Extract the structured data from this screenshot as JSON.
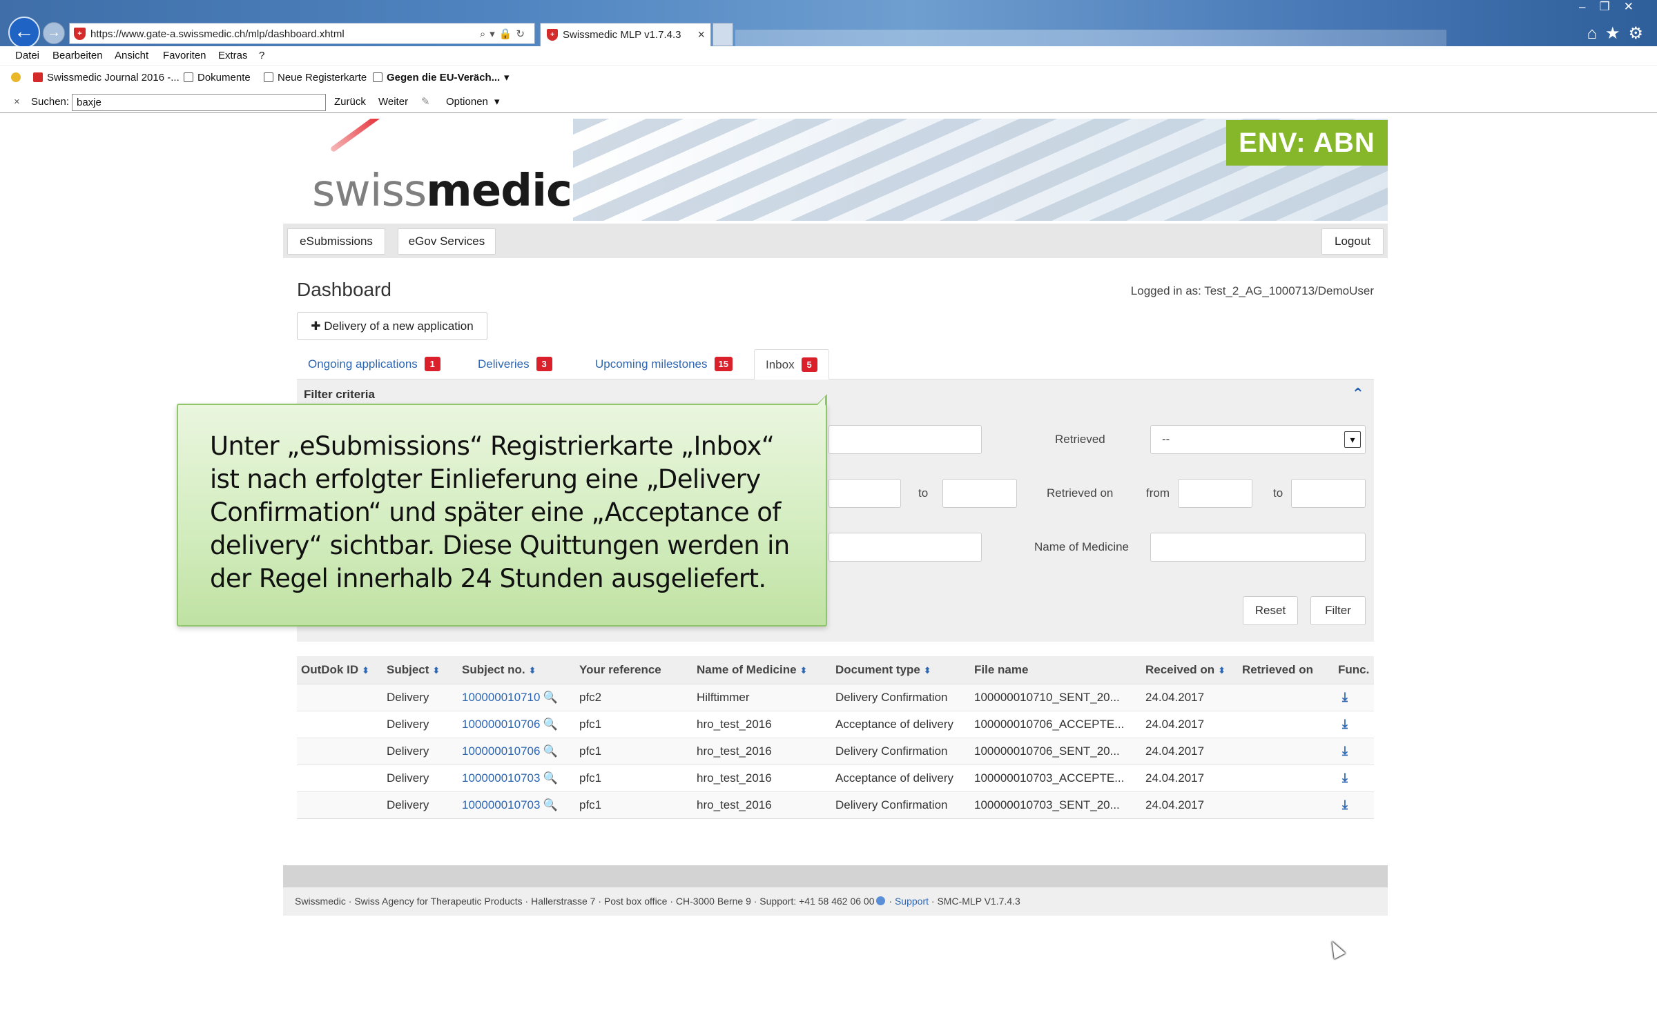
{
  "browser": {
    "url": "https://www.gate-a.swissmedic.ch/mlp/dashboard.xhtml",
    "address_tools": "⌕▾🔒↻",
    "tab_title": "Swissmedic MLP v1.7.4.3",
    "tab_close": "×",
    "back": "←",
    "forward": "→",
    "window_controls": "–❐✕",
    "right_icons": "⌂★⚙",
    "menu": [
      "Datei",
      "Bearbeiten",
      "Ansicht",
      "Favoriten",
      "Extras",
      "?"
    ],
    "favorites": [
      "Swissmedic Journal 2016 -...",
      "Dokumente",
      "Neue Registerkarte",
      "Gegen die EU-Veräch..."
    ],
    "favorites_more": "▾",
    "find": {
      "close": "×",
      "label": "Suchen:",
      "value": "baxje",
      "back": "Zurück",
      "next": "Weiter",
      "options": "Optionen",
      "options_arrow": "▾"
    }
  },
  "header": {
    "logo_light": "swiss",
    "logo_bold": "medic",
    "env_badge": "ENV: ABN"
  },
  "nav": {
    "esubmissions": "eSubmissions",
    "egov": "eGov Services",
    "logout": "Logout"
  },
  "dashboard": {
    "title": "Dashboard",
    "logged_in": "Logged in as: Test_2_AG_1000713/DemoUser",
    "new_application": "Delivery of a new application",
    "new_application_icon": "✚"
  },
  "tabs": [
    {
      "label": "Ongoing applications",
      "count": "1"
    },
    {
      "label": "Deliveries",
      "count": "3"
    },
    {
      "label": "Upcoming milestones",
      "count": "15"
    },
    {
      "label": "Inbox",
      "count": "5"
    }
  ],
  "filter": {
    "title": "Filter criteria",
    "collapse": "⌃",
    "retrieved_label": "Retrieved",
    "retrieved_value": "--",
    "retrieved_arrow": "▾",
    "to_label": "to",
    "retrieved_on_label": "Retrieved on",
    "from_label": "from",
    "to_label_2": "to",
    "medicine_label": "Name of Medicine",
    "reset": "Reset",
    "filter": "Filter"
  },
  "table": {
    "sort_icon": "⬍",
    "search_icon": "🔍",
    "download_icon": "⤓",
    "columns": [
      "OutDok ID",
      "Subject",
      "Subject no.",
      "Your reference",
      "Name of Medicine",
      "Document type",
      "File name",
      "Received on",
      "Retrieved on",
      "Func."
    ],
    "rows": [
      {
        "outdok": "",
        "subject": "Delivery",
        "subject_no": "100000010710",
        "reference": "pfc2",
        "medicine": "Hilftimmer",
        "doc_type": "Delivery Confirmation",
        "file": "100000010710_SENT_20...",
        "received": "24.04.2017",
        "retrieved": ""
      },
      {
        "outdok": "",
        "subject": "Delivery",
        "subject_no": "100000010706",
        "reference": "pfc1",
        "medicine": "hro_test_2016",
        "doc_type": "Acceptance of delivery",
        "file": "100000010706_ACCEPTE...",
        "received": "24.04.2017",
        "retrieved": ""
      },
      {
        "outdok": "",
        "subject": "Delivery",
        "subject_no": "100000010706",
        "reference": "pfc1",
        "medicine": "hro_test_2016",
        "doc_type": "Delivery Confirmation",
        "file": "100000010706_SENT_20...",
        "received": "24.04.2017",
        "retrieved": ""
      },
      {
        "outdok": "",
        "subject": "Delivery",
        "subject_no": "100000010703",
        "reference": "pfc1",
        "medicine": "hro_test_2016",
        "doc_type": "Acceptance of delivery",
        "file": "100000010703_ACCEPTE...",
        "received": "24.04.2017",
        "retrieved": ""
      },
      {
        "outdok": "",
        "subject": "Delivery",
        "subject_no": "100000010703",
        "reference": "pfc1",
        "medicine": "hro_test_2016",
        "doc_type": "Delivery Confirmation",
        "file": "100000010703_SENT_20...",
        "received": "24.04.2017",
        "retrieved": ""
      }
    ]
  },
  "footer": {
    "text": "Swissmedic · Swiss Agency for Therapeutic Products · Hallerstrasse 7 · Post box office · CH-3000 Berne 9 · Support: +41 58 462 06 00",
    "sep1": " · ",
    "support_link": "Support",
    "sep2": " · ",
    "version": "SMC-MLP V1.7.4.3"
  },
  "callout": {
    "text": "Unter „eSubmissions“ Registrierkarte „Inbox“ ist nach erfolgter Einlieferung eine „Delivery Confirmation“ und später eine „Acceptance of delivery“ sichtbar. Diese Quittungen werden in der Regel innerhalb 24 Stunden ausgeliefert."
  },
  "colors": {
    "accent_blue": "#2c66b2",
    "badge_red": "#d9202b",
    "env_green": "#86b72a",
    "callout_green": "#d2ecbd"
  }
}
